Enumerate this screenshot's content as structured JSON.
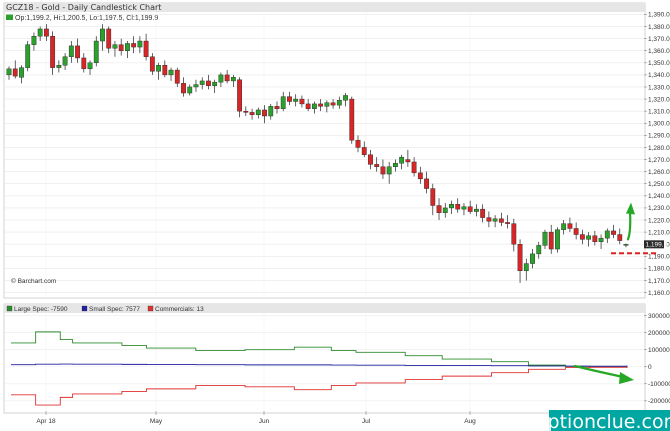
{
  "title": "GCZ18 - Gold - Daily Candlestick Chart",
  "ohlc_readout": "Op:1,199.2, Hi:1,200.5, Lo:1,197.5, Cl:1,199.9",
  "last_price_label": "1,199.9",
  "credit": "© Barchart.com",
  "watermark": "optionclue.com",
  "chart_data": [
    {
      "type": "candlestick",
      "title": "GCZ18 - Gold - Daily Candlestick Chart",
      "yticks": [
        1160,
        1170,
        1180,
        1190,
        1200,
        1210,
        1220,
        1230,
        1240,
        1250,
        1260,
        1270,
        1280,
        1290,
        1300,
        1310,
        1320,
        1330,
        1340,
        1350,
        1360,
        1370,
        1380,
        1390
      ],
      "ytick_labels": [
        "1,160.0",
        "1,170.0",
        "1,180.0",
        "1,190.0",
        "1,200.0",
        "1,210.0",
        "1,220.0",
        "1,230.0",
        "1,240.0",
        "1,250.0",
        "1,260.0",
        "1,270.0",
        "1,280.0",
        "1,290.0",
        "1,300.0",
        "1,310.0",
        "1,320.0",
        "1,330.0",
        "1,340.0",
        "1,350.0",
        "1,360.0",
        "1,370.0",
        "1,380.0",
        "1,390.0"
      ],
      "ylim": [
        1158,
        1392
      ],
      "xtick_labels": [
        "Apr 18",
        "May",
        "Jun",
        "Jul",
        "Aug"
      ],
      "colors": {
        "up": "#2ca02c",
        "down": "#d62728"
      },
      "last_close": 1199.9,
      "annotations": [
        "green arrow pointing up",
        "red dashed support line near 1,192"
      ],
      "candles": [
        [
          1340,
          1347,
          1336,
          1345
        ],
        [
          1345,
          1352,
          1337,
          1339
        ],
        [
          1338,
          1348,
          1333,
          1346
        ],
        [
          1346,
          1368,
          1343,
          1365
        ],
        [
          1365,
          1375,
          1360,
          1372
        ],
        [
          1372,
          1380,
          1368,
          1378
        ],
        [
          1378,
          1382,
          1368,
          1372
        ],
        [
          1372,
          1376,
          1340,
          1346
        ],
        [
          1346,
          1352,
          1342,
          1348
        ],
        [
          1348,
          1358,
          1344,
          1355
        ],
        [
          1355,
          1368,
          1350,
          1364
        ],
        [
          1364,
          1370,
          1350,
          1354
        ],
        [
          1354,
          1358,
          1342,
          1345
        ],
        [
          1345,
          1352,
          1340,
          1350
        ],
        [
          1350,
          1372,
          1347,
          1368
        ],
        [
          1368,
          1382,
          1360,
          1378
        ],
        [
          1378,
          1380,
          1358,
          1362
        ],
        [
          1362,
          1368,
          1355,
          1365
        ],
        [
          1365,
          1370,
          1356,
          1360
        ],
        [
          1360,
          1368,
          1354,
          1366
        ],
        [
          1366,
          1372,
          1358,
          1363
        ],
        [
          1363,
          1372,
          1358,
          1368
        ],
        [
          1368,
          1374,
          1352,
          1355
        ],
        [
          1355,
          1358,
          1340,
          1343
        ],
        [
          1343,
          1350,
          1336,
          1348
        ],
        [
          1348,
          1352,
          1338,
          1340
        ],
        [
          1340,
          1346,
          1335,
          1344
        ],
        [
          1344,
          1346,
          1330,
          1333
        ],
        [
          1333,
          1338,
          1322,
          1325
        ],
        [
          1325,
          1332,
          1323,
          1330
        ],
        [
          1330,
          1336,
          1326,
          1332
        ],
        [
          1332,
          1338,
          1328,
          1335
        ],
        [
          1335,
          1340,
          1328,
          1331
        ],
        [
          1331,
          1336,
          1325,
          1334
        ],
        [
          1334,
          1342,
          1330,
          1340
        ],
        [
          1340,
          1344,
          1333,
          1335
        ],
        [
          1335,
          1340,
          1330,
          1338
        ],
        [
          1336,
          1338,
          1305,
          1310
        ],
        [
          1310,
          1314,
          1306,
          1309
        ],
        [
          1309,
          1312,
          1303,
          1307
        ],
        [
          1307,
          1313,
          1304,
          1311
        ],
        [
          1311,
          1315,
          1300,
          1306
        ],
        [
          1306,
          1316,
          1303,
          1314
        ],
        [
          1314,
          1318,
          1308,
          1312
        ],
        [
          1312,
          1326,
          1310,
          1322
        ],
        [
          1322,
          1326,
          1315,
          1318
        ],
        [
          1318,
          1324,
          1314,
          1320
        ],
        [
          1320,
          1323,
          1313,
          1316
        ],
        [
          1316,
          1320,
          1310,
          1312
        ],
        [
          1312,
          1318,
          1308,
          1316
        ],
        [
          1316,
          1320,
          1310,
          1314
        ],
        [
          1314,
          1319,
          1309,
          1317
        ],
        [
          1317,
          1320,
          1312,
          1315
        ],
        [
          1315,
          1322,
          1312,
          1319
        ],
        [
          1319,
          1325,
          1314,
          1323
        ],
        [
          1320,
          1322,
          1283,
          1286
        ],
        [
          1286,
          1290,
          1276,
          1280
        ],
        [
          1280,
          1285,
          1272,
          1274
        ],
        [
          1274,
          1278,
          1262,
          1266
        ],
        [
          1266,
          1272,
          1260,
          1264
        ],
        [
          1264,
          1270,
          1254,
          1258
        ],
        [
          1258,
          1268,
          1250,
          1264
        ],
        [
          1264,
          1270,
          1260,
          1267
        ],
        [
          1267,
          1274,
          1262,
          1272
        ],
        [
          1270,
          1278,
          1264,
          1268
        ],
        [
          1268,
          1272,
          1256,
          1259
        ],
        [
          1259,
          1264,
          1250,
          1254
        ],
        [
          1254,
          1260,
          1242,
          1246
        ],
        [
          1246,
          1250,
          1224,
          1232
        ],
        [
          1232,
          1238,
          1220,
          1226
        ],
        [
          1226,
          1234,
          1222,
          1230
        ],
        [
          1230,
          1236,
          1225,
          1233
        ],
        [
          1233,
          1238,
          1226,
          1229
        ],
        [
          1229,
          1234,
          1224,
          1231
        ],
        [
          1231,
          1236,
          1225,
          1227
        ],
        [
          1227,
          1233,
          1223,
          1229
        ],
        [
          1229,
          1233,
          1218,
          1222
        ],
        [
          1222,
          1227,
          1214,
          1219
        ],
        [
          1219,
          1224,
          1214,
          1221
        ],
        [
          1221,
          1226,
          1215,
          1218
        ],
        [
          1218,
          1224,
          1213,
          1217
        ],
        [
          1217,
          1221,
          1194,
          1200
        ],
        [
          1200,
          1204,
          1168,
          1178
        ],
        [
          1178,
          1188,
          1170,
          1184
        ],
        [
          1184,
          1196,
          1180,
          1192
        ],
        [
          1192,
          1202,
          1188,
          1199
        ],
        [
          1199,
          1212,
          1196,
          1210
        ],
        [
          1210,
          1216,
          1192,
          1196
        ],
        [
          1196,
          1214,
          1193,
          1212
        ],
        [
          1212,
          1220,
          1208,
          1217
        ],
        [
          1217,
          1222,
          1210,
          1213
        ],
        [
          1213,
          1218,
          1204,
          1208
        ],
        [
          1208,
          1212,
          1200,
          1204
        ],
        [
          1204,
          1210,
          1198,
          1207
        ],
        [
          1207,
          1211,
          1199,
          1202
        ],
        [
          1202,
          1208,
          1196,
          1205
        ],
        [
          1205,
          1213,
          1201,
          1211
        ],
        [
          1211,
          1216,
          1205,
          1208
        ],
        [
          1208,
          1213,
          1200,
          1203
        ],
        [
          1199.2,
          1200.5,
          1197.5,
          1199.9
        ]
      ]
    },
    {
      "type": "line",
      "title": "",
      "yticks": [
        -200000,
        -100000,
        0,
        100000,
        200000,
        300000
      ],
      "ytick_labels": [
        "-200000",
        "-100000",
        "0",
        "100000",
        "200000",
        "300000"
      ],
      "ylim": [
        -260000,
        310000
      ],
      "legend_placement": "top-left",
      "step": true,
      "x": [
        0,
        4,
        8,
        10,
        18,
        22,
        30,
        38,
        46,
        52,
        56,
        64,
        70,
        78,
        84,
        90,
        94,
        100
      ],
      "series": [
        {
          "name": "Large Spec: -7590",
          "color": "#2e8b2e",
          "values": [
            140000,
            205000,
            160000,
            140000,
            125000,
            110000,
            95000,
            100000,
            115000,
            95000,
            85000,
            65000,
            45000,
            30000,
            10000,
            2000,
            -2000,
            -7590
          ]
        },
        {
          "name": "Small Spec: 7577",
          "color": "#1f1fa0",
          "values": [
            12000,
            15000,
            16000,
            15000,
            14000,
            13000,
            12000,
            11000,
            11000,
            10000,
            9000,
            8000,
            7000,
            6000,
            5000,
            4000,
            3000,
            7577
          ]
        },
        {
          "name": "Commercials: 13",
          "color": "#e03030",
          "values": [
            -165000,
            -225000,
            -180000,
            -160000,
            -145000,
            -130000,
            -110000,
            -118000,
            -135000,
            -110000,
            -95000,
            -75000,
            -55000,
            -35000,
            -15000,
            -5000,
            -3000,
            13
          ]
        }
      ]
    }
  ]
}
